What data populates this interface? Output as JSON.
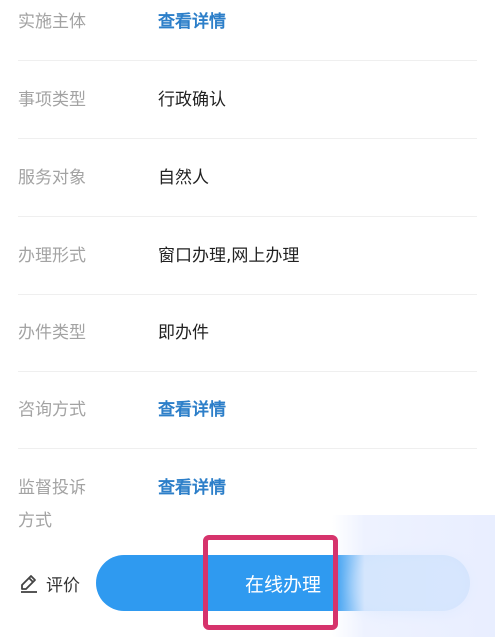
{
  "details": {
    "rows": [
      {
        "label": "实施主体",
        "value": "查看详情",
        "is_link": true
      },
      {
        "label": "事项类型",
        "value": "行政确认",
        "is_link": false
      },
      {
        "label": "服务对象",
        "value": "自然人",
        "is_link": false
      },
      {
        "label": "办理形式",
        "value": "窗口办理,网上办理",
        "is_link": false
      },
      {
        "label": "办件类型",
        "value": "即办件",
        "is_link": false
      },
      {
        "label": "咨询方式",
        "value": "查看详情",
        "is_link": true
      },
      {
        "label_line1": "监督投诉",
        "label_line2": "方式",
        "value": "查看详情",
        "is_link": true
      }
    ]
  },
  "bottom_bar": {
    "evaluate_label": "评价",
    "evaluate_icon": "pencil-icon",
    "online_button_label": "在线办理"
  },
  "colors": {
    "link": "#2d7fc9",
    "primary_button": "#2f9af0",
    "highlight_border": "#d6336c",
    "label_text": "#a3a3a3"
  }
}
